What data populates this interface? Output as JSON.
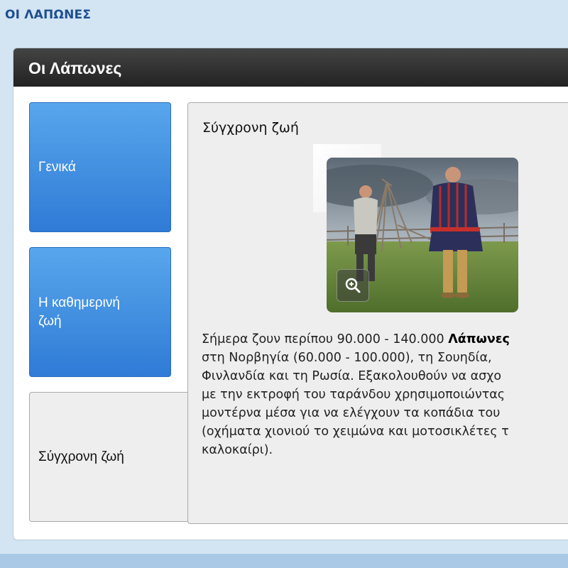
{
  "page": {
    "top_title": "ΟΙ ΛΑΠΩΝΕΣ"
  },
  "panel": {
    "title": "Οι Λάπωνες"
  },
  "tabs": [
    {
      "label": "Γενικά",
      "state": "inactive"
    },
    {
      "label": "Η καθημερινή ζωή",
      "state": "inactive"
    },
    {
      "label": "Σύγχρονη ζωή",
      "state": "active"
    }
  ],
  "content": {
    "title": "Σύγχρονη ζωή",
    "image_alt_icon": "zoom-in-icon",
    "paragraph": {
      "line1_before_bold": "Σήμερα ζουν περίπου 90.000 - 140.000 ",
      "line1_bold": "Λάπωνες",
      "line2": "στη Νορβηγία (60.000 - 100.000), τη Σουηδία,",
      "line3": "Φινλανδία και τη Ρωσία. Εξακολουθούν να ασχο",
      "line4": "με την εκτροφή του ταράνδου χρησιμοποιώντας",
      "line5": "μοντέρνα μέσα για να ελέγχουν τα κοπάδια του",
      "line6": "(οχήματα χιονιού το χειμώνα και μοτοσικλέτες τ",
      "line7": "καλοκαίρι)."
    }
  },
  "colors": {
    "page_bg": "#d3e4f3",
    "top_title": "#1e4f8e",
    "tab_blue_top": "#58a6ec",
    "tab_blue_bottom": "#2f7bd6",
    "header_bg": "#2b2b2b",
    "content_bg": "#eeeeee"
  }
}
